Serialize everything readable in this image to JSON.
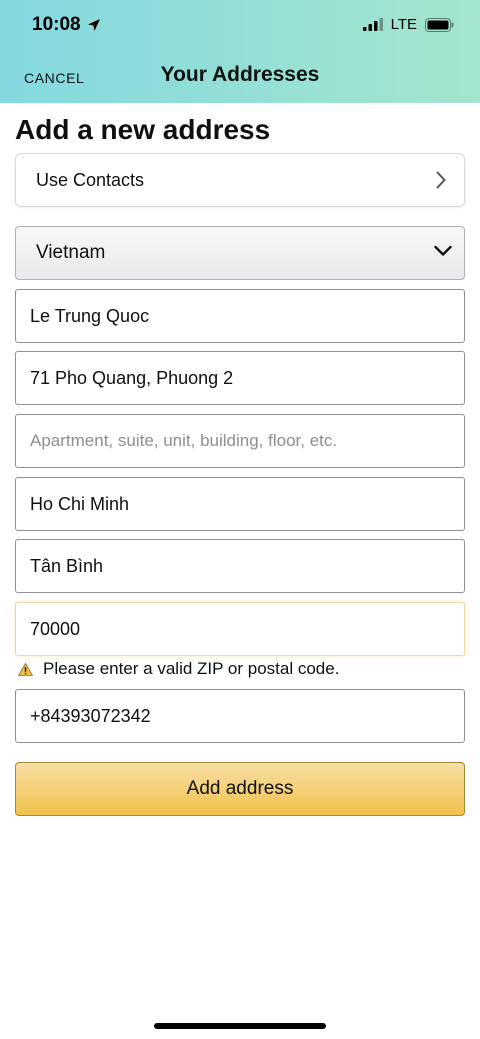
{
  "status_bar": {
    "time": "10:08",
    "network": "LTE",
    "icons": [
      "location-arrow-icon",
      "signal-bars-icon",
      "battery-icon"
    ]
  },
  "nav": {
    "cancel_label": "CANCEL",
    "title": "Your Addresses"
  },
  "page": {
    "heading": "Add a new address"
  },
  "form": {
    "use_contacts_label": "Use Contacts",
    "country_selected": "Vietnam",
    "full_name": "Le Trung Quoc",
    "address_line1": "71 Pho Quang, Phuong 2",
    "address_line2_placeholder": "Apartment, suite, unit, building, floor, etc.",
    "city": "Ho Chi Minh",
    "state_region": "Tân Bình",
    "zip": "70000",
    "zip_error": "Please enter a valid ZIP or postal code.",
    "phone": "+84393072342",
    "submit_label": "Add address"
  },
  "colors": {
    "header_gradient_start": "#84d8e0",
    "header_gradient_end": "#a5e5cf",
    "button_top": "#f7dfa5",
    "button_bottom": "#f0c14b",
    "warning": "#f0c14b"
  }
}
